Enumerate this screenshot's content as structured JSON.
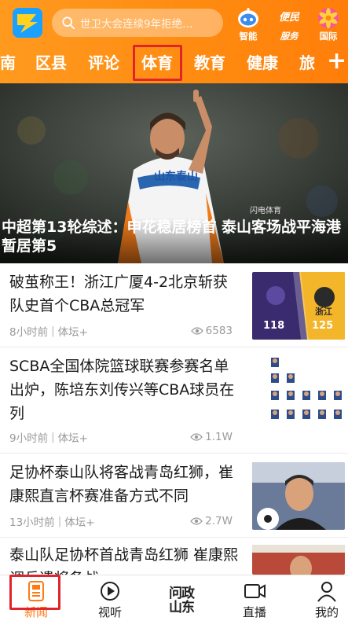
{
  "header": {
    "search_placeholder": "世卫大会连续9年拒绝…",
    "icons": [
      {
        "name": "smart",
        "label": "智能"
      },
      {
        "name": "service",
        "label": "服务",
        "badge_text": "便民"
      },
      {
        "name": "international",
        "label": "国际"
      }
    ]
  },
  "tabs": [
    {
      "label": "南"
    },
    {
      "label": "区县"
    },
    {
      "label": "评论"
    },
    {
      "label": "体育",
      "active": true
    },
    {
      "label": "教育"
    },
    {
      "label": "健康"
    },
    {
      "label": "旅"
    }
  ],
  "hero": {
    "caption": "中超第13轮综述：申花稳居榜首 泰山客场战平海港暂居第5",
    "jersey_text": "山东泰山",
    "watermark": "闪电体育"
  },
  "news": [
    {
      "title": "破茧称王！浙江广厦4-2北京斩获队史首个CBA总冠军",
      "time": "8小时前",
      "source": "体坛+",
      "views": "6583",
      "thumb": {
        "score_left": "118",
        "score_right": "125",
        "team_right": "浙江"
      }
    },
    {
      "title": "SCBA全国体院篮球联赛参赛名单出炉，陈培东刘传兴等CBA球员在列",
      "time": "9小时前",
      "source": "体坛+",
      "views": "1.1W"
    },
    {
      "title": "足协杯泰山队将客战青岛红狮，崔康熙直言杯赛准备方式不同",
      "time": "13小时前",
      "source": "体坛+",
      "views": "2.7W"
    },
    {
      "title": "泰山队足协杯首战青岛红狮 崔康熙调兵遣将备战",
      "time": "",
      "source": "",
      "views": ""
    }
  ],
  "bottom_nav": [
    {
      "label": "新闻",
      "icon": "news-icon",
      "active": true
    },
    {
      "label": "视听",
      "icon": "play-icon"
    },
    {
      "label": "问政山东",
      "icon": "wenzheng-logo"
    },
    {
      "label": "直播",
      "icon": "video-camera-icon"
    },
    {
      "label": "我的",
      "icon": "user-icon"
    }
  ],
  "colors": {
    "header_gradient_start": "#ff9a1f",
    "header_gradient_end": "#ff7e0a",
    "highlight_red": "#e0242b",
    "active_nav": "#ff7a12",
    "meta_gray": "#9a9a9a"
  }
}
